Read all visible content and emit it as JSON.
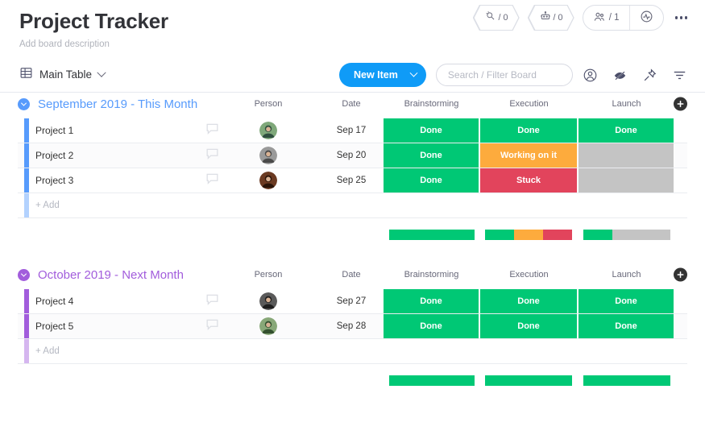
{
  "header": {
    "title": "Project Tracker",
    "description": "Add board description",
    "badges": [
      {
        "icon": "magic-search-icon",
        "value": "/ 0"
      },
      {
        "icon": "robot-icon",
        "value": "/ 0"
      }
    ],
    "members": {
      "icon": "people-icon",
      "value": "/ 1"
    },
    "activity": {
      "icon": "activity-pulse-icon"
    },
    "more_menu": "more-options"
  },
  "toolbar": {
    "table_tab": {
      "icon": "table-grid-icon",
      "label": "Main Table"
    },
    "new_item_label": "New Item",
    "search": {
      "placeholder": "Search / Filter Board",
      "value": ""
    },
    "icons": [
      "person-circle-icon",
      "hide-eye-icon",
      "pin-icon",
      "filter-icon"
    ]
  },
  "columns": {
    "person": "Person",
    "date": "Date",
    "statuses": [
      "Brainstorming",
      "Execution",
      "Launch"
    ],
    "add_column": "+"
  },
  "colors": {
    "done": "#00c875",
    "working": "#fdab3d",
    "stuck": "#e2445c",
    "empty": "#c4c4c4",
    "blue": "#579bfc",
    "purple": "#a25ddc",
    "accent_blue": "#0f9bf7"
  },
  "groups": [
    {
      "title": "September 2019 - This Month",
      "color": "#579bfc",
      "add_label": "+ Add",
      "rows": [
        {
          "name": "Project 1",
          "date": "Sep 17",
          "avatar": "avatar-green",
          "statuses": [
            {
              "label": "Done",
              "color": "#00c875"
            },
            {
              "label": "Done",
              "color": "#00c875"
            },
            {
              "label": "Done",
              "color": "#00c875"
            }
          ]
        },
        {
          "name": "Project 2",
          "date": "Sep 20",
          "avatar": "avatar-grey",
          "statuses": [
            {
              "label": "Done",
              "color": "#00c875"
            },
            {
              "label": "Working on it",
              "color": "#fdab3d"
            },
            {
              "label": "",
              "color": "#c4c4c4"
            }
          ]
        },
        {
          "name": "Project 3",
          "date": "Sep 25",
          "avatar": "avatar-dark",
          "statuses": [
            {
              "label": "Done",
              "color": "#00c875"
            },
            {
              "label": "Stuck",
              "color": "#e2445c"
            },
            {
              "label": "",
              "color": "#c4c4c4"
            }
          ]
        }
      ],
      "summary": [
        [
          {
            "color": "#00c875",
            "pct": 100
          }
        ],
        [
          {
            "color": "#00c875",
            "pct": 33.34
          },
          {
            "color": "#fdab3d",
            "pct": 33.33
          },
          {
            "color": "#e2445c",
            "pct": 33.33
          }
        ],
        [
          {
            "color": "#00c875",
            "pct": 33.34
          },
          {
            "color": "#c4c4c4",
            "pct": 66.66
          }
        ]
      ]
    },
    {
      "title": "October 2019 - Next Month",
      "color": "#a25ddc",
      "add_label": "+ Add",
      "rows": [
        {
          "name": "Project 4",
          "date": "Sep 27",
          "avatar": "avatar-dark2",
          "statuses": [
            {
              "label": "Done",
              "color": "#00c875"
            },
            {
              "label": "Done",
              "color": "#00c875"
            },
            {
              "label": "Done",
              "color": "#00c875"
            }
          ]
        },
        {
          "name": "Project 5",
          "date": "Sep 28",
          "avatar": "avatar-green2",
          "statuses": [
            {
              "label": "Done",
              "color": "#00c875"
            },
            {
              "label": "Done",
              "color": "#00c875"
            },
            {
              "label": "Done",
              "color": "#00c875"
            }
          ]
        }
      ],
      "summary": [
        [
          {
            "color": "#00c875",
            "pct": 100
          }
        ],
        [
          {
            "color": "#00c875",
            "pct": 100
          }
        ],
        [
          {
            "color": "#00c875",
            "pct": 100
          }
        ]
      ]
    }
  ]
}
